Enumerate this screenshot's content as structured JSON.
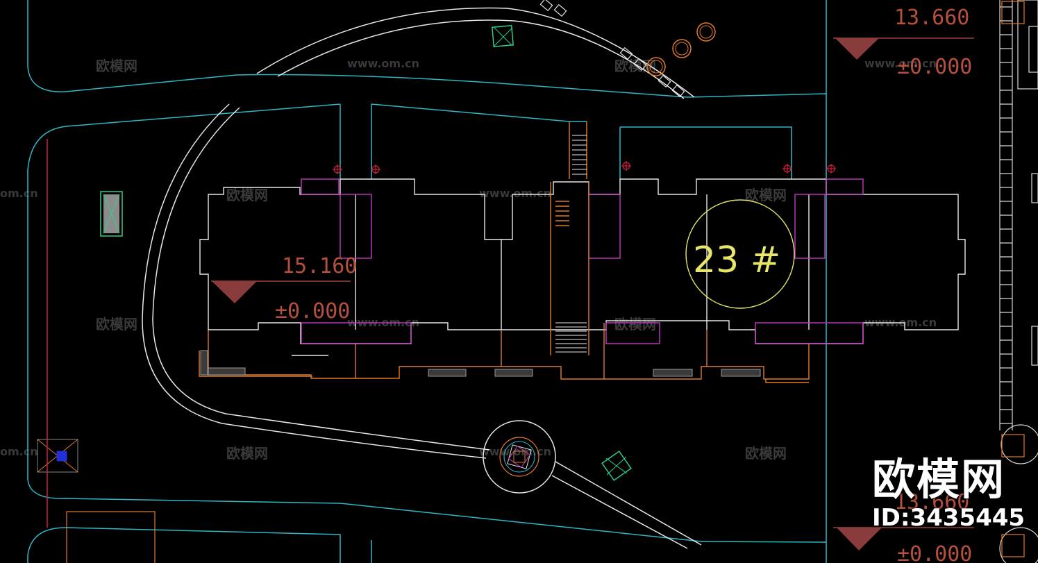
{
  "drawing": {
    "elevations": {
      "top_right_high": "13.660",
      "top_right_zero": "±0.000",
      "building_high": "15.160",
      "building_zero": "±0.000",
      "bottom_right_partial": "13.660",
      "bottom_right_zero": "±0.000"
    },
    "building_label": "23 #",
    "watermark_name": "欧模网",
    "watermark_url": "www.om.cn",
    "watermark_url_partial": "om.cn"
  },
  "brand": {
    "name": "欧模网",
    "id": "ID:3435445"
  },
  "colors": {
    "background": "#000000",
    "road_cyan": "#2fb7c8",
    "path_white": "#e8e8e8",
    "wall_magenta": "#c23bc2",
    "stair_orange": "#e07a2a",
    "axis_red": "#d21d3c",
    "tree_green": "#2fcf8a",
    "label_yellow": "#e6e66a",
    "elevation_brown": "#b4503c"
  }
}
